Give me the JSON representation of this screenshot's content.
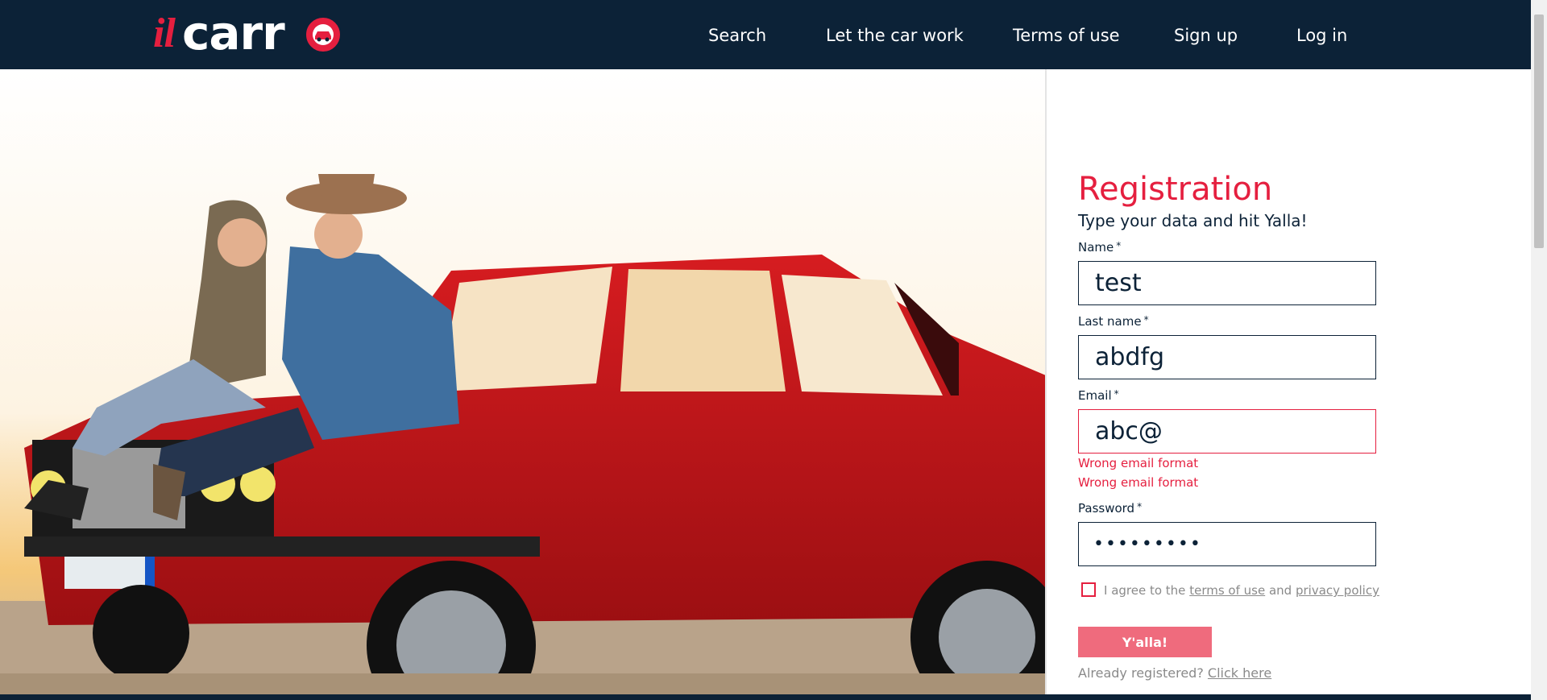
{
  "header": {
    "logo_il": "il",
    "logo_carro": "carr",
    "nav": [
      "Search",
      "Let the car work",
      "Terms of use",
      "Sign up",
      "Log in"
    ]
  },
  "colors": {
    "navy": "#0c2237",
    "accent": "#e51f3f",
    "button": "#ef6b7d"
  },
  "form": {
    "title": "Registration",
    "subtitle": "Type your data and hit Yalla!",
    "fields": {
      "name": {
        "label": "Name",
        "value": "test"
      },
      "last_name": {
        "label": "Last name",
        "value": "abdfg"
      },
      "email": {
        "label": "Email",
        "value": "abc@"
      },
      "password": {
        "label": "Password",
        "value": "•••••••••"
      }
    },
    "required_mark": "*",
    "email_errors": [
      "Wrong email format",
      "Wrong email format"
    ],
    "agree": {
      "prefix": "I agree to the",
      "terms_link": "terms of use",
      "middle": "and",
      "privacy_link": "privacy policy"
    },
    "submit": "Y'alla!",
    "already": {
      "text": "Already registered?",
      "link": "Click here"
    }
  }
}
